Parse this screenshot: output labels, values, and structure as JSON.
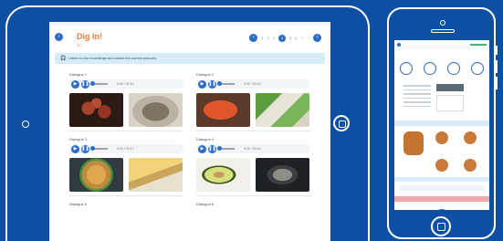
{
  "tablet": {
    "title": "Dig In!",
    "subtitle": "10",
    "instruction": "Listen to the recordings and select the correct pictures.",
    "pager": {
      "prev": "‹",
      "next": "›",
      "pages": [
        "1",
        "2",
        "3",
        "4",
        "5",
        "6",
        "7",
        "..."
      ],
      "active_index": 3
    },
    "dialogues": [
      {
        "label": "Dialogue 1",
        "time": "0:00 / 00:13",
        "pictures": [
          "meatballs",
          "roast"
        ]
      },
      {
        "label": "Dialogue 2",
        "time": "0:00 / 00:10",
        "pictures": [
          "tomato",
          "salad"
        ]
      },
      {
        "label": "Dialogue 3",
        "time": "0:00 / 00:17",
        "pictures": [
          "ramen",
          "quiche"
        ]
      },
      {
        "label": "Dialogue 4",
        "time": "0:00 / 00:15",
        "pictures": [
          "avocado",
          "fish"
        ]
      }
    ],
    "next_dialogue_labels": [
      "Dialogue 5",
      "Dialogue 6"
    ]
  },
  "colors": {
    "background": "#0d4fa3",
    "accent": "#2d6cc6",
    "title": "#f07a38",
    "instruction_band": "#d7ebf8"
  },
  "icons": {
    "back": "chevron-left-icon",
    "play": "play-icon",
    "pause": "pause-icon",
    "instruction": "headphones-icon"
  }
}
